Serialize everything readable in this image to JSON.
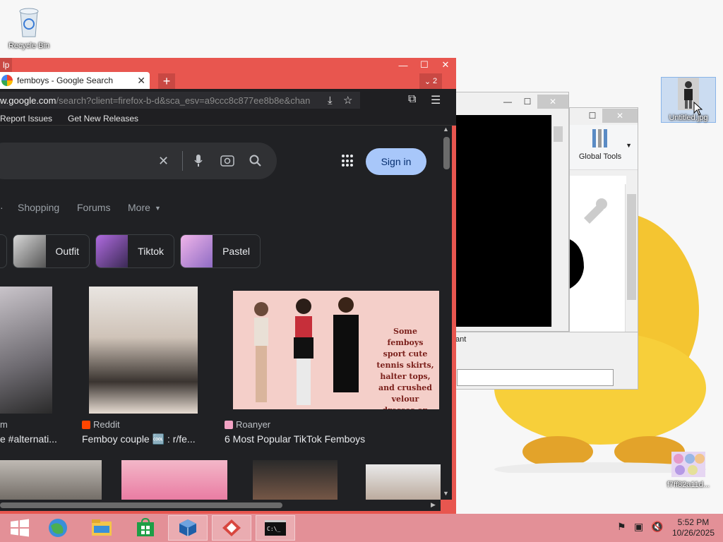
{
  "desktop": {
    "icons": {
      "recycle_bin": "Recycle Bin",
      "untitled_jpg": "Untitled.jpg",
      "image_file": "f7ff82a11d..."
    }
  },
  "bg_windows": {
    "partial_text": "ant",
    "global_tools": "Global Tools"
  },
  "firefox": {
    "app_menu_fragment": "lp",
    "tab_title": "femboys - Google Search",
    "tab_count": "2",
    "url_host": "w.google.com",
    "url_path": "/search?client=firefox-b-d&sca_esv=a9ccc8c877ee8b8e&chan",
    "bookmarks": [
      "Report Issues",
      "Get New Releases"
    ]
  },
  "google": {
    "sign_in": "Sign in",
    "filters": [
      "Shopping",
      "Forums",
      "More"
    ],
    "chips": [
      "Outfit",
      "Tiktok",
      "Pastel"
    ],
    "results": [
      {
        "source": "m",
        "title": "e #alternati..."
      },
      {
        "source": "Reddit",
        "title": "Femboy couple 🆒 : r/fe..."
      },
      {
        "source": "Roanyer",
        "title": "6 Most Popular TikTok Femboys"
      }
    ],
    "promo_text": "Some femboys sport cute tennis skirts, halter tops, and crushed velour dresses on TikTok."
  },
  "taskbar": {
    "time": "5:52 PM",
    "date": "10/26/2025"
  }
}
